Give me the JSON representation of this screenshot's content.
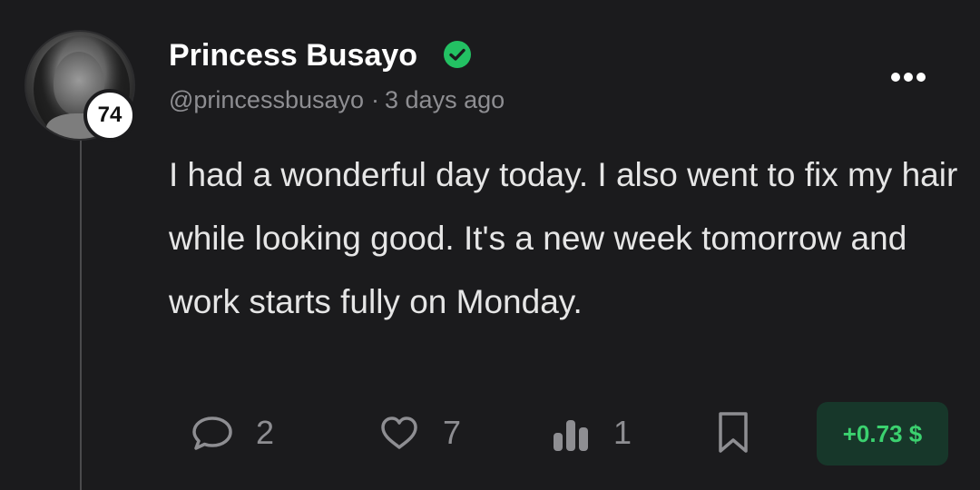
{
  "author": {
    "name": "Princess Busayo",
    "handle": "@princessbusayo",
    "level": "74",
    "verified": true
  },
  "post": {
    "separator": "·",
    "time": "3 days ago",
    "text": "I had a wonderful day today. I also went to fix my hair while looking good. It's a new week tomorrow and work starts fully on Monday."
  },
  "actions": {
    "comments": "2",
    "likes": "7",
    "views": "1",
    "tip": "+0.73 $"
  },
  "icons": {
    "verified": "verified-check-icon",
    "more": "more-horizontal-icon",
    "comment": "comment-bubble-icon",
    "like": "heart-icon",
    "views": "bar-chart-icon",
    "bookmark": "bookmark-icon"
  },
  "colors": {
    "background": "#1b1b1d",
    "verified": "#23c163",
    "tip_text": "#3bd16f",
    "tip_bg": "#17372a",
    "muted": "#8e8e92"
  }
}
